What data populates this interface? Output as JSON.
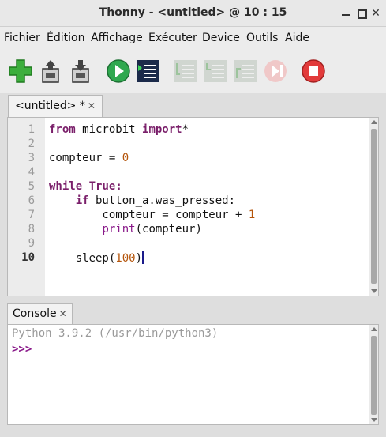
{
  "window": {
    "title": "Thonny  -  <untitled>  @  10 : 15",
    "minimize_icon": "minimize-icon",
    "maximize_icon": "maximize-icon",
    "close_glyph": "✕"
  },
  "menu": [
    "Fichier",
    "Édition",
    "Affichage",
    "Exécuter",
    "Device",
    "Outils",
    "Aide"
  ],
  "toolbar": {
    "icons": [
      "new-file-icon",
      "open-file-icon",
      "save-file-icon",
      "run-icon",
      "debug-icon",
      "step-over-icon",
      "step-into-icon",
      "step-out-icon",
      "resume-icon",
      "stop-icon"
    ],
    "enabled": [
      true,
      true,
      true,
      true,
      true,
      false,
      false,
      false,
      false,
      true
    ]
  },
  "editor": {
    "tab_label": "<untitled> *",
    "close_glyph": "✕",
    "line_numbers": [
      "1",
      "2",
      "3",
      "4",
      "5",
      "6",
      "7",
      "8",
      "9",
      "10"
    ],
    "current_line": "10",
    "code": {
      "l1_kw1": "from",
      "l1_mod": " microbit ",
      "l1_kw2": "import",
      "l1_rest": "*",
      "l3_a": "compteur = ",
      "l3_num": "0",
      "l5_kw1": "while",
      "l5_sp": " ",
      "l5_kw2": "True",
      "l5_colon": ":",
      "l6_indent": "    ",
      "l6_kw": "if",
      "l6_rest": " button_a.was_pressed:",
      "l7_a": "        compteur = compteur + ",
      "l7_num": "1",
      "l8_indent": "        ",
      "l8_fn": "print",
      "l8_rest": "(compteur)",
      "l10_a": "    sleep(",
      "l10_num": "100",
      "l10_b": ")"
    }
  },
  "console": {
    "tab_label": "Console",
    "close_glyph": "✕",
    "banner": "Python 3.9.2 (/usr/bin/python3)",
    "prompt": ">>>"
  },
  "colors": {
    "keyword": "#7a1f6a",
    "number": "#b4540a",
    "prompt": "#8a1a8a"
  }
}
